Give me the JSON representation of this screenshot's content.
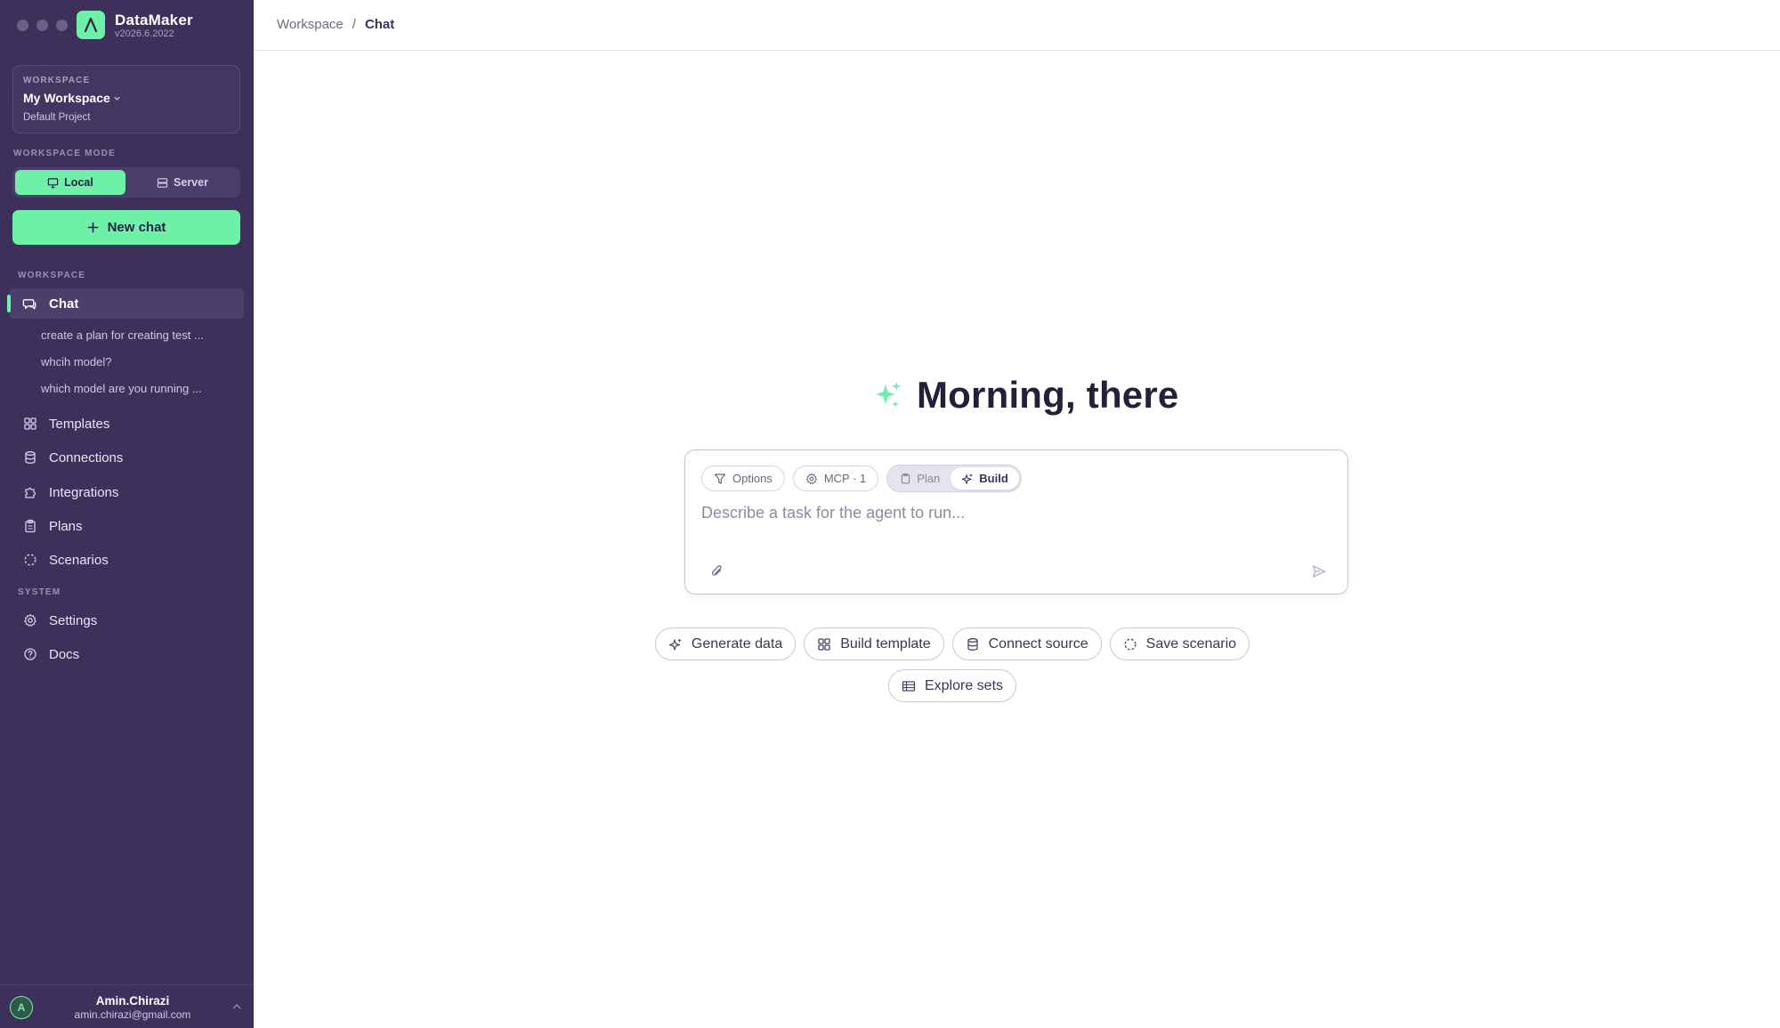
{
  "app": {
    "name": "DataMaker",
    "version": "v2026.6.2022"
  },
  "workspace_card": {
    "caption": "WORKSPACE",
    "name": "My Workspace",
    "project": "Default Project"
  },
  "mode": {
    "label": "WORKSPACE MODE",
    "options": [
      "Local",
      "Server"
    ],
    "selected": "Local"
  },
  "new_chat_label": "New chat",
  "sections": {
    "workspace": "WORKSPACE",
    "system": "SYSTEM"
  },
  "nav": {
    "chat": "Chat",
    "chat_history": [
      "create a plan for creating test ...",
      "whcih model?",
      "which model are you running ..."
    ],
    "templates": "Templates",
    "connections": "Connections",
    "integrations": "Integrations",
    "plans": "Plans",
    "scenarios": "Scenarios",
    "settings": "Settings",
    "docs": "Docs"
  },
  "user": {
    "initial": "A",
    "name": "Amin.Chirazi",
    "email": "amin.chirazi@gmail.com"
  },
  "breadcrumb": {
    "root": "Workspace",
    "separator": "/",
    "current": "Chat"
  },
  "greeting": "Morning, there",
  "composer": {
    "options_label": "Options",
    "mcp_label": "MCP · 1",
    "modes": [
      "Plan",
      "Build"
    ],
    "selected_mode": "Build",
    "placeholder": "Describe a task for the agent to run..."
  },
  "suggestions": [
    "Generate data",
    "Build template",
    "Connect source",
    "Save scenario",
    "Explore sets"
  ],
  "colors": {
    "sidebar": "#3d315c",
    "accent": "#6ef0a8",
    "text_dark": "#23203a"
  }
}
